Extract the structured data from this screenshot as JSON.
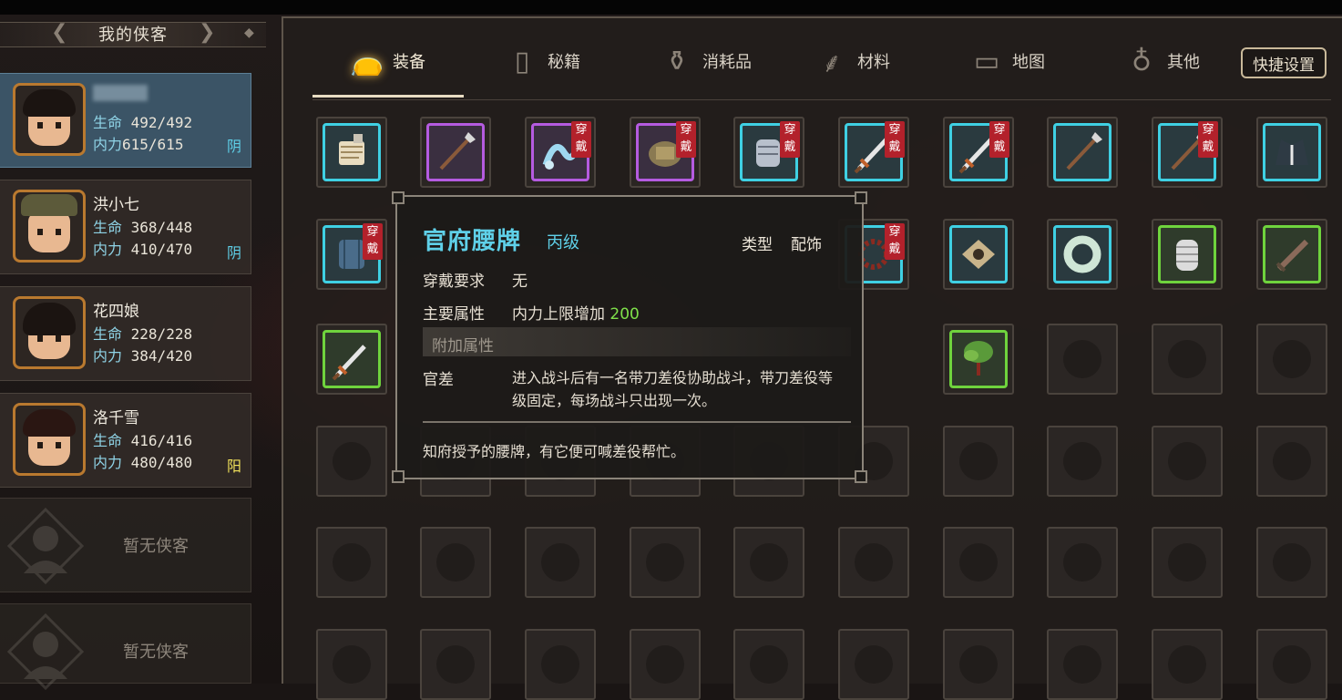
{
  "left_panel": {
    "title": "我的侠客",
    "heroes": [
      {
        "name": "",
        "hp_label": "生命",
        "hp": "492/492",
        "mp_label": "内力",
        "mp": "615/615",
        "alignment": "阴",
        "alignment_color": "#5fd0e8"
      },
      {
        "name": "洪小七",
        "hp_label": "生命",
        "hp": "368/448",
        "mp_label": "内力",
        "mp": "410/470",
        "alignment": "阴",
        "alignment_color": "#5fd0e8"
      },
      {
        "name": "花四娘",
        "hp_label": "生命",
        "hp": "228/228",
        "mp_label": "内力",
        "mp": "384/420",
        "alignment": "",
        "alignment_color": "#5fd0e8"
      },
      {
        "name": "洛千雪",
        "hp_label": "生命",
        "hp": "416/416",
        "mp_label": "内力",
        "mp": "480/480",
        "alignment": "阳",
        "alignment_color": "#f0e05a"
      }
    ],
    "empty_slot_text": "暂无侠客"
  },
  "tabs": [
    {
      "label": "装备",
      "icon": "equipment-bag-icon",
      "active": true
    },
    {
      "label": "秘籍",
      "icon": "book-icon",
      "active": false
    },
    {
      "label": "消耗品",
      "icon": "potion-icon",
      "active": false
    },
    {
      "label": "材料",
      "icon": "herb-icon",
      "active": false
    },
    {
      "label": "地图",
      "icon": "map-icon",
      "active": false
    },
    {
      "label": "其他",
      "icon": "lantern-icon",
      "active": false
    }
  ],
  "quick_settings_label": "快捷设置",
  "equipped_badge": "穿戴",
  "inventory": {
    "row1": [
      {
        "item": "scroll-bundle",
        "rarity": "cyan",
        "equipped": false
      },
      {
        "item": "spear",
        "rarity": "purple",
        "equipped": false
      },
      {
        "item": "silk-sash",
        "rarity": "purple",
        "equipped": true
      },
      {
        "item": "token-plaque",
        "rarity": "purple",
        "equipped": true
      },
      {
        "item": "gauntlet",
        "rarity": "cyan",
        "equipped": true
      },
      {
        "item": "sword",
        "rarity": "cyan",
        "equipped": true
      },
      {
        "item": "sword",
        "rarity": "cyan",
        "equipped": true
      },
      {
        "item": "spear",
        "rarity": "cyan",
        "equipped": false
      },
      {
        "item": "spear",
        "rarity": "cyan",
        "equipped": true
      },
      {
        "item": "robe",
        "rarity": "cyan",
        "equipped": false
      }
    ],
    "row2_visible": [
      {
        "item": "armor-vest",
        "rarity": "cyan",
        "equipped": true
      },
      {
        "item": "prayer-beads",
        "rarity": "cyan",
        "equipped": true
      },
      {
        "item": "cloth-wrap",
        "rarity": "cyan",
        "equipped": false
      },
      {
        "item": "jade-ring",
        "rarity": "cyan",
        "equipped": false
      },
      {
        "item": "hand-wraps",
        "rarity": "green",
        "equipped": false
      },
      {
        "item": "broadsword",
        "rarity": "green",
        "equipped": false
      }
    ],
    "row3_visible": [
      {
        "item": "sword",
        "rarity": "green",
        "equipped": false
      },
      {
        "item": "herb-bundle",
        "rarity": "green",
        "equipped": false
      }
    ]
  },
  "tooltip": {
    "name": "官府腰牌",
    "grade": "丙级",
    "type_label": "类型",
    "type_value": "配饰",
    "requirement_label": "穿戴要求",
    "requirement_value": "无",
    "main_attr_label": "主要属性",
    "main_attr_value": "内力上限增加",
    "main_attr_amount": "200",
    "extra_attr_header": "附加属性",
    "extra_attr_label": "官差",
    "extra_attr_desc": "进入战斗后有一名带刀差役协助战斗，带刀差役等级固定，每场战斗只出现一次。",
    "flavor": "知府授予的腰牌，有它便可喊差役帮忙。"
  }
}
